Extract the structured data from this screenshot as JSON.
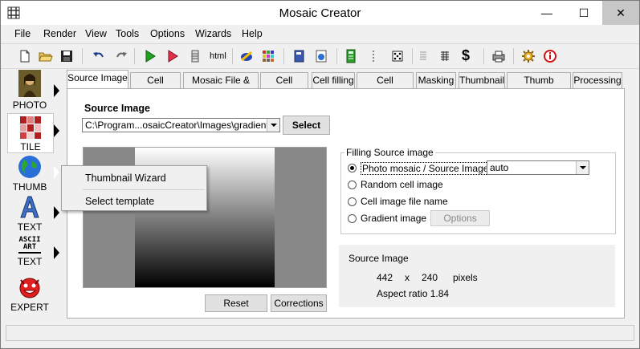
{
  "window": {
    "title": "Mosaic Creator",
    "min": "—",
    "max": "☐",
    "close": "✕"
  },
  "menu": [
    "File",
    "Render",
    "View",
    "Tools",
    "Options",
    "Wizards",
    "Help"
  ],
  "toolbar": {
    "html_label": "html"
  },
  "left_panel": [
    {
      "label": "PHOTO",
      "icon": "mona-lisa-icon"
    },
    {
      "label": "TILE",
      "icon": "tile-grid-icon"
    },
    {
      "label": "THUMB",
      "icon": "globe-icon"
    },
    {
      "label": "TEXT",
      "icon": "letter-a-icon"
    },
    {
      "label": "TEXT",
      "icon": "ascii-art-icon",
      "art": [
        "ASCII",
        "ART"
      ]
    },
    {
      "label": "EXPERT",
      "icon": "devil-face-icon"
    }
  ],
  "tabs": [
    "Source Image",
    "Cell Images",
    "Mosaic File & Size",
    "Cell Shape",
    "Cell filling",
    "Cell Enhance",
    "Masking",
    "Thumbnail",
    "Thumb Images",
    "Processing"
  ],
  "source": {
    "heading": "Source Image",
    "path": "C:\\Program...osaicCreator\\Images\\gradient.bmp",
    "select_label": "Select",
    "reset_label": "Reset",
    "corrections_label": "Corrections"
  },
  "filling": {
    "group_title": "Filling Source image",
    "options": [
      "Photo mosaic / Source Image",
      "Random cell image",
      "Cell image file name",
      "Gradient image"
    ],
    "selected": 0,
    "mode_value": "auto",
    "options_button": "Options"
  },
  "info": {
    "title": "Source Image",
    "width": "442",
    "x": "x",
    "height": "240",
    "unit": "pixels",
    "aspect": "Aspect ratio 1.84"
  },
  "popup": {
    "items": [
      "Thumbnail Wizard",
      "Select template"
    ]
  }
}
